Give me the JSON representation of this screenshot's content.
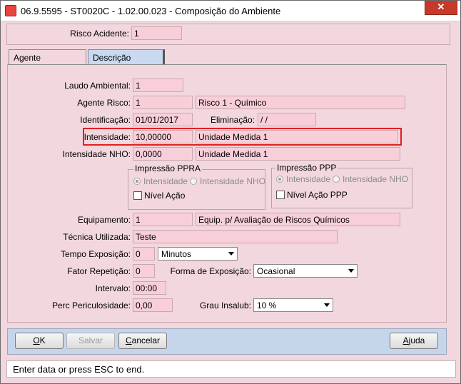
{
  "window": {
    "title": "06.9.5595 - ST0020C - 1.02.00.023 - Composição do Ambiente",
    "close_glyph": "✕"
  },
  "header": {
    "risco_acidente_label": "Risco Acidente:",
    "risco_acidente_value": "1"
  },
  "tabs": [
    {
      "label": "Agente",
      "active": true
    },
    {
      "label": "Descrição",
      "active": false
    }
  ],
  "form": {
    "laudo_label": "Laudo Ambiental:",
    "laudo_value": "1",
    "agente_label": "Agente Risco:",
    "agente_code": "1",
    "agente_desc": "Risco  1 - Químico",
    "identificacao_label": "Identificação:",
    "identificacao_value": "01/01/2017",
    "eliminacao_label": "Eliminação:",
    "eliminacao_value": " / /",
    "intensidade_label": "Intensidade:",
    "intensidade_value": "10,00000",
    "intensidade_unit": "Unidade Medida 1",
    "nho_label": "Intensidade NHO:",
    "nho_value": "0,0000",
    "nho_unit": "Unidade Medida 1",
    "ppra": {
      "title": "Impressão PPRA",
      "opt1": "Intensidade",
      "opt2": "Intensidade NHO",
      "check": "Nível Ação"
    },
    "ppp": {
      "title": "Impressão PPP",
      "opt1": "Intensidade",
      "opt2": "Intensidade NHO",
      "check": "Nível Ação PPP"
    },
    "equip_label": "Equipamento:",
    "equip_code": "1",
    "equip_desc": "Equip. p/ Avaliação de Riscos Químicos",
    "tecnica_label": "Técnica Utilizada:",
    "tecnica_value": "Teste",
    "tempo_label": "Tempo Exposição:",
    "tempo_value": "0",
    "tempo_unit": "Minutos",
    "fator_label": "Fator Repetição:",
    "fator_value": "0",
    "forma_label": "Forma de Exposição:",
    "forma_value": "Ocasional",
    "intervalo_label": "Intervalo:",
    "intervalo_value": "00:00",
    "perc_label": "Perc Periculosidade:",
    "perc_value": "0,00",
    "grau_label": "Grau Insalub:",
    "grau_value": "10 %"
  },
  "buttons": {
    "ok_k": "O",
    "ok_rest": "K",
    "salvar": "Salvar",
    "cancelar_k": "C",
    "cancelar_rest": "ancelar",
    "ajuda_k": "A",
    "ajuda_rest": "juda"
  },
  "status": "Enter data or press ESC to end."
}
